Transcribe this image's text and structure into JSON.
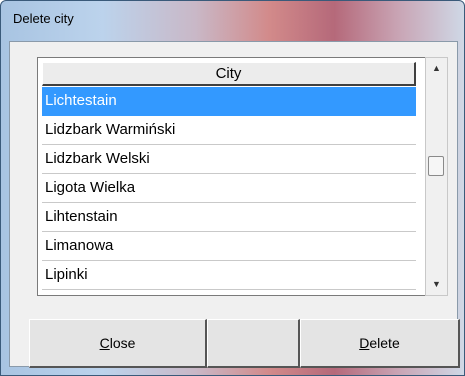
{
  "window": {
    "title": "Delete city"
  },
  "table": {
    "column_header": "City",
    "rows": [
      "Lichtestain",
      "Lidzbark Warmiński",
      "Lidzbark Welski",
      "Ligota Wielka",
      "Lihtenstain",
      "Limanowa",
      "Lipinki"
    ],
    "selected_index": 0
  },
  "scrollbar": {
    "up_icon": "up-arrow-icon",
    "down_icon": "down-arrow-icon"
  },
  "buttons": {
    "close": {
      "mnemonic": "C",
      "rest": "lose"
    },
    "delete": {
      "mnemonic": "D",
      "rest": "elete"
    }
  },
  "colors": {
    "selection": "#3399ff",
    "selection_text": "#ffffff"
  }
}
